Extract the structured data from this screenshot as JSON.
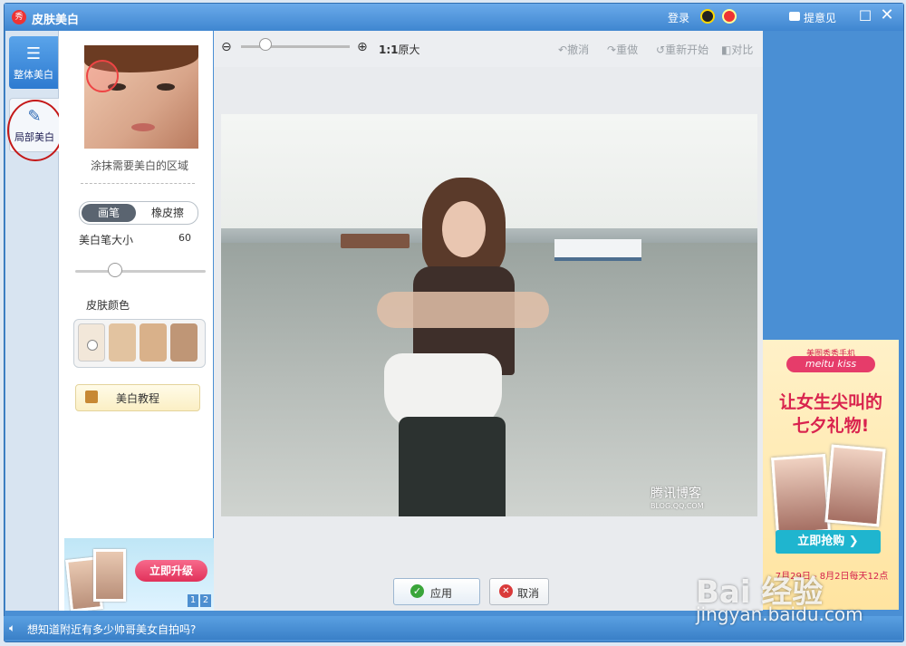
{
  "window": {
    "title": "皮肤美白",
    "logo": "秀"
  },
  "titlebar": {
    "login": "登录",
    "feedback": "提意见",
    "maximize_glyph": "☐",
    "close_glyph": "✕"
  },
  "tabs": [
    {
      "label": "整体美白",
      "icon": "sliders-icon",
      "glyph": "☰"
    },
    {
      "label": "局部美白",
      "icon": "brush-icon",
      "glyph": "✎"
    }
  ],
  "panel": {
    "hint": "涂抹需要美白的区域",
    "brush_label": "画笔",
    "eraser_label": "橡皮擦",
    "size_label": "美白笔大小",
    "size_value": "60",
    "skin_label": "皮肤颜色",
    "tutorial_label": "美白教程",
    "swatch_colors": [
      "#f2e7d9",
      "#e2c3a0",
      "#d9b18a",
      "#bf9676"
    ]
  },
  "ad_left": {
    "button": "立即升级",
    "pages": [
      "1",
      "2"
    ]
  },
  "editor": {
    "zoom_out_glyph": "⊖",
    "zoom_in_glyph": "⊕",
    "original_ratio": "1:1",
    "original_label": "原大",
    "undo": "撤消",
    "redo": "重做",
    "restart": "重新开始",
    "compare": "对比",
    "photo_watermark": "腾讯博客",
    "photo_watermark_sub": "BLOG.QQ.COM",
    "apply_label": "应用",
    "cancel_label": "取消"
  },
  "ad_right": {
    "small": "美图秀秀手机",
    "brand": "meitu kiss",
    "line1": "让女生尖叫的",
    "line2": "七夕礼物!",
    "button": "立即抢购 ❯",
    "date": "7月29日 - 8月2日每天12点"
  },
  "statusbar": {
    "text": "想知道附近有多少帅哥美女自拍吗?"
  },
  "overlay": {
    "baidu": "Bai 经验",
    "url": "jingyan.baidu.com"
  },
  "colors": {
    "accent": "#4a8fd4",
    "apply_green": "#3aa53a",
    "cancel_red": "#d93a3a",
    "ad_pink": "#d9234e",
    "ad_cyan": "#1fb5cf"
  }
}
